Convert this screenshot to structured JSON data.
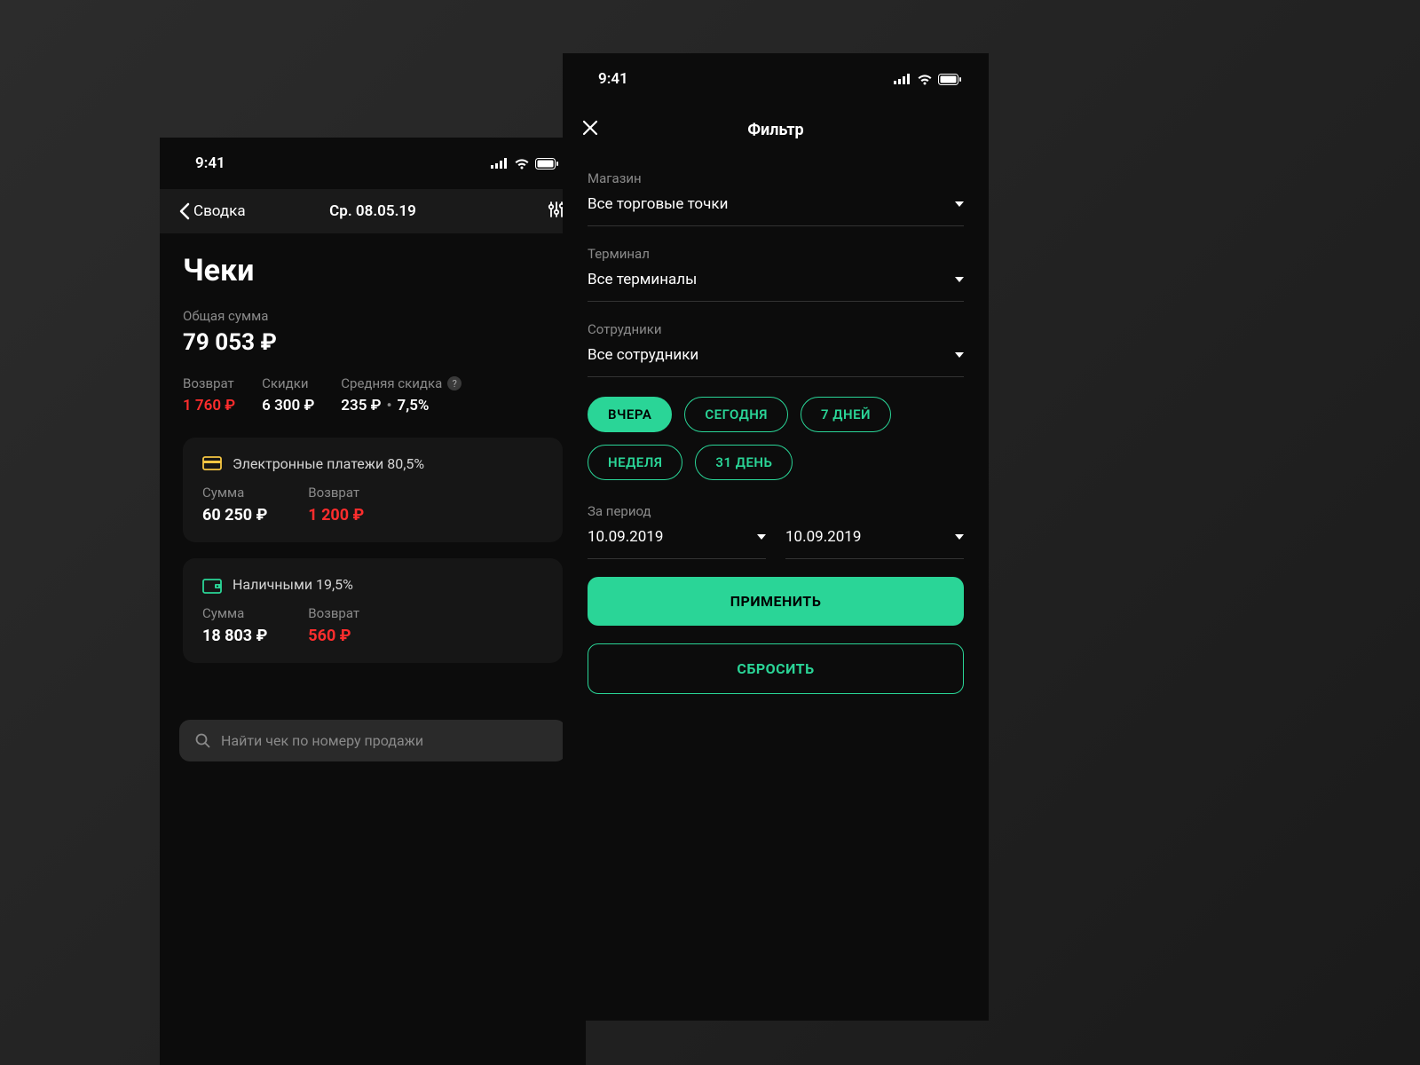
{
  "status": {
    "time": "9:41"
  },
  "receipts": {
    "nav": {
      "back": "Сводка",
      "date": "Ср. 08.05.19"
    },
    "title": "Чеки",
    "total_label": "Общая сумма",
    "total_value": "79 053 ₽",
    "stats": {
      "refund_label": "Возврат",
      "refund_value": "1 760 ₽",
      "discounts_label": "Скидки",
      "discounts_value": "6 300 ₽",
      "avg_discount_label": "Средняя скидка",
      "avg_discount_amount": "235 ₽",
      "avg_discount_percent": "7,5%"
    },
    "card_electronic": {
      "title": "Электронные платежи 80,5%",
      "sum_label": "Сумма",
      "sum_value": "60 250 ₽",
      "refund_label": "Возврат",
      "refund_value": "1 200 ₽"
    },
    "card_cash": {
      "title": "Наличными 19,5%",
      "sum_label": "Сумма",
      "sum_value": "18 803 ₽",
      "refund_label": "Возврат",
      "refund_value": "560 ₽"
    },
    "search_placeholder": "Найти чек по номеру продажи"
  },
  "filter": {
    "title": "Фильтр",
    "store_label": "Магазин",
    "store_value": "Все торговые точки",
    "terminal_label": "Терминал",
    "terminal_value": "Все терминалы",
    "employees_label": "Сотрудники",
    "employees_value": "Все сотрудники",
    "chips": {
      "yesterday": "ВЧЕРА",
      "today": "СЕГОДНЯ",
      "seven_days": "7 ДНЕЙ",
      "week": "НЕДЕЛЯ",
      "thirtyone_days": "31 ДЕНЬ"
    },
    "period_label": "За период",
    "period_from": "10.09.2019",
    "period_to": "10.09.2019",
    "apply": "ПРИМЕНИТЬ",
    "reset": "СБРОСИТЬ"
  },
  "colors": {
    "accent": "#2ad597",
    "danger": "#ff2d2d"
  }
}
